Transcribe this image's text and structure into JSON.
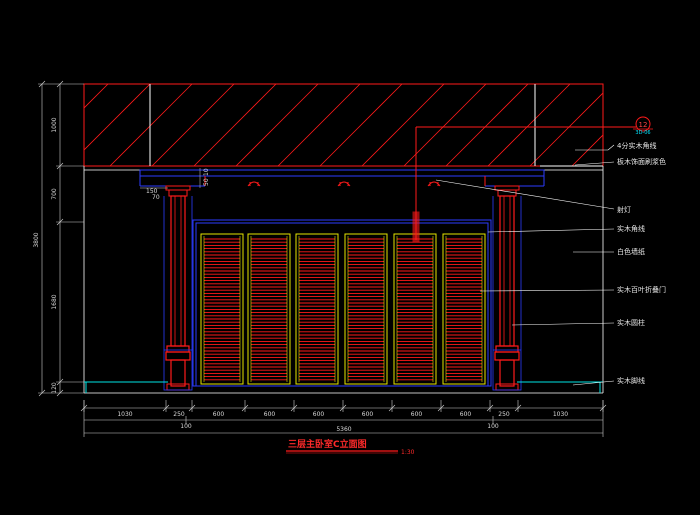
{
  "drawing": {
    "title": "三层主卧室C立面图",
    "scale": "1:30",
    "detail_tag": {
      "number": "12",
      "sheet": "3D-06"
    },
    "colors": {
      "background": "#000000",
      "red": "#ff1a1a",
      "blue": "#2b3bff",
      "yellow": "#e6e600",
      "white": "#ffffff",
      "cyan": "#00e5e5",
      "dim": "#cfcfcf"
    }
  },
  "annotations": [
    "4分实木角线",
    "板木饰面刷浆色",
    "射灯",
    "实木角线",
    "白色墙纸",
    "实木百叶折叠门",
    "实木圆柱",
    "实木脚线"
  ],
  "dimensions": {
    "left_vertical": [
      "1000",
      "700",
      "1680",
      "120"
    ],
    "left_total": "3800",
    "bottom_segments": [
      "1030",
      "250",
      "600",
      "600",
      "600",
      "600",
      "600",
      "600",
      "250",
      "1030"
    ],
    "bottom_mid": [
      "100",
      "100"
    ],
    "bottom_total": "5360",
    "small_left": [
      "150",
      "70"
    ],
    "small_vertical": [
      "10",
      "50"
    ]
  }
}
